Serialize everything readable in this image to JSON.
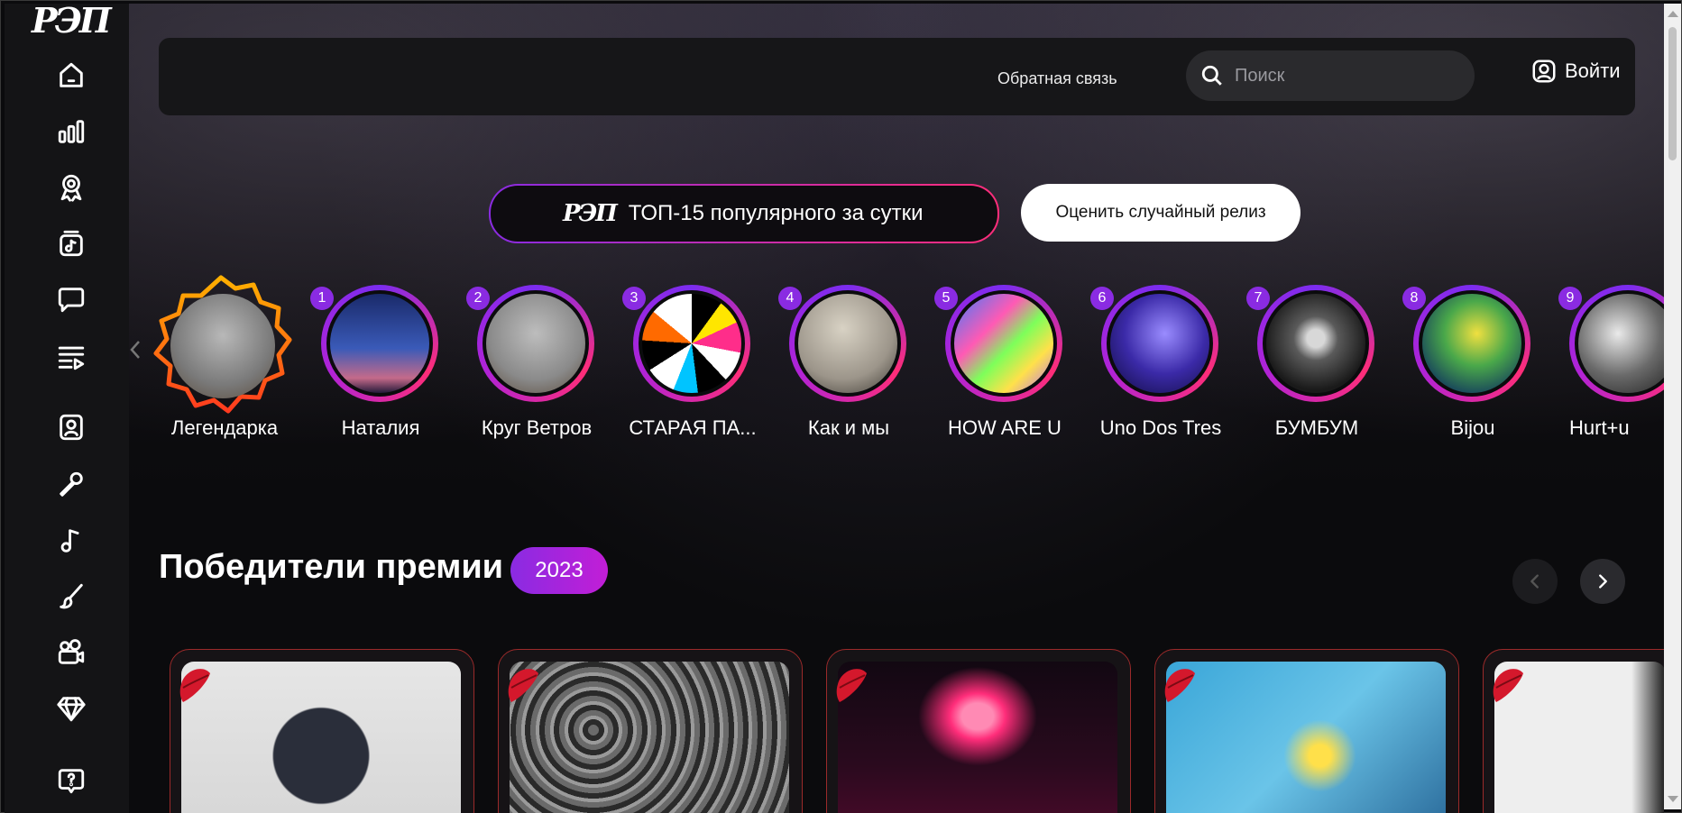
{
  "brand": {
    "logo_text": "РЭП"
  },
  "header": {
    "feedback_label": "Обратная связь",
    "search_placeholder": "Поиск",
    "login_label": "Войти"
  },
  "promo": {
    "top15_label": "ТОП-15 популярного за сутки",
    "random_label": "Оценить случайный релиз"
  },
  "stories": [
    {
      "rank": "",
      "name": "Легендарка"
    },
    {
      "rank": "1",
      "name": "Наталия"
    },
    {
      "rank": "2",
      "name": "Круг Ветров"
    },
    {
      "rank": "3",
      "name": "СТАРАЯ ПА..."
    },
    {
      "rank": "4",
      "name": "Как и мы"
    },
    {
      "rank": "5",
      "name": "HOW ARE U"
    },
    {
      "rank": "6",
      "name": "Uno Dos Tres"
    },
    {
      "rank": "7",
      "name": "БУМБУМ"
    },
    {
      "rank": "8",
      "name": "Bijou"
    },
    {
      "rank": "9",
      "name": "Hurt+u"
    }
  ],
  "winners": {
    "title": "Победители премии",
    "year": "2023"
  },
  "colors": {
    "accent_purple": "#8a2be2",
    "accent_pink": "#ff2d7a",
    "card_border": "#9b2a2a",
    "legend_ring": "#ff6a00"
  }
}
